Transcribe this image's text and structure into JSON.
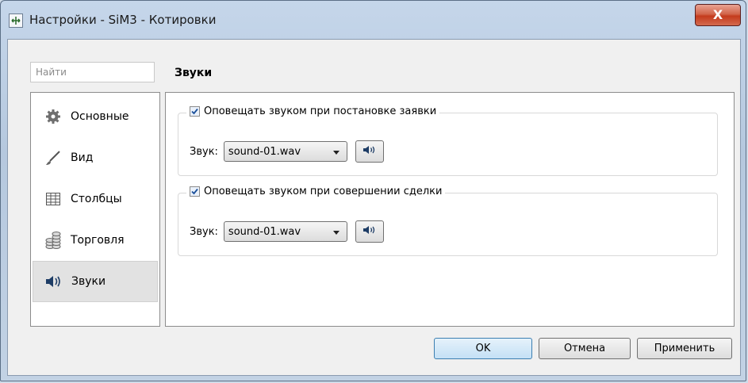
{
  "window": {
    "title": "Настройки - SiM3 - Котировки",
    "close_glyph": "X"
  },
  "search": {
    "placeholder": "Найти"
  },
  "section": {
    "title": "Звуки"
  },
  "nav": {
    "items": [
      {
        "label": "Основные",
        "icon": "gear-icon"
      },
      {
        "label": "Вид",
        "icon": "brush-icon"
      },
      {
        "label": "Столбцы",
        "icon": "table-icon"
      },
      {
        "label": "Торговля",
        "icon": "coins-icon"
      },
      {
        "label": "Звуки",
        "icon": "speaker-icon",
        "active": true
      }
    ]
  },
  "groups": [
    {
      "check_label": "Оповещать звуком при постановке заявки",
      "checked": true,
      "sound_label": "Звук:",
      "sound_value": "sound-01.wav"
    },
    {
      "check_label": "Оповещать звуком при совершении сделки",
      "checked": true,
      "sound_label": "Звук:",
      "sound_value": "sound-01.wav"
    }
  ],
  "buttons": {
    "ok": "OK",
    "cancel": "Отмена",
    "apply": "Применить"
  }
}
